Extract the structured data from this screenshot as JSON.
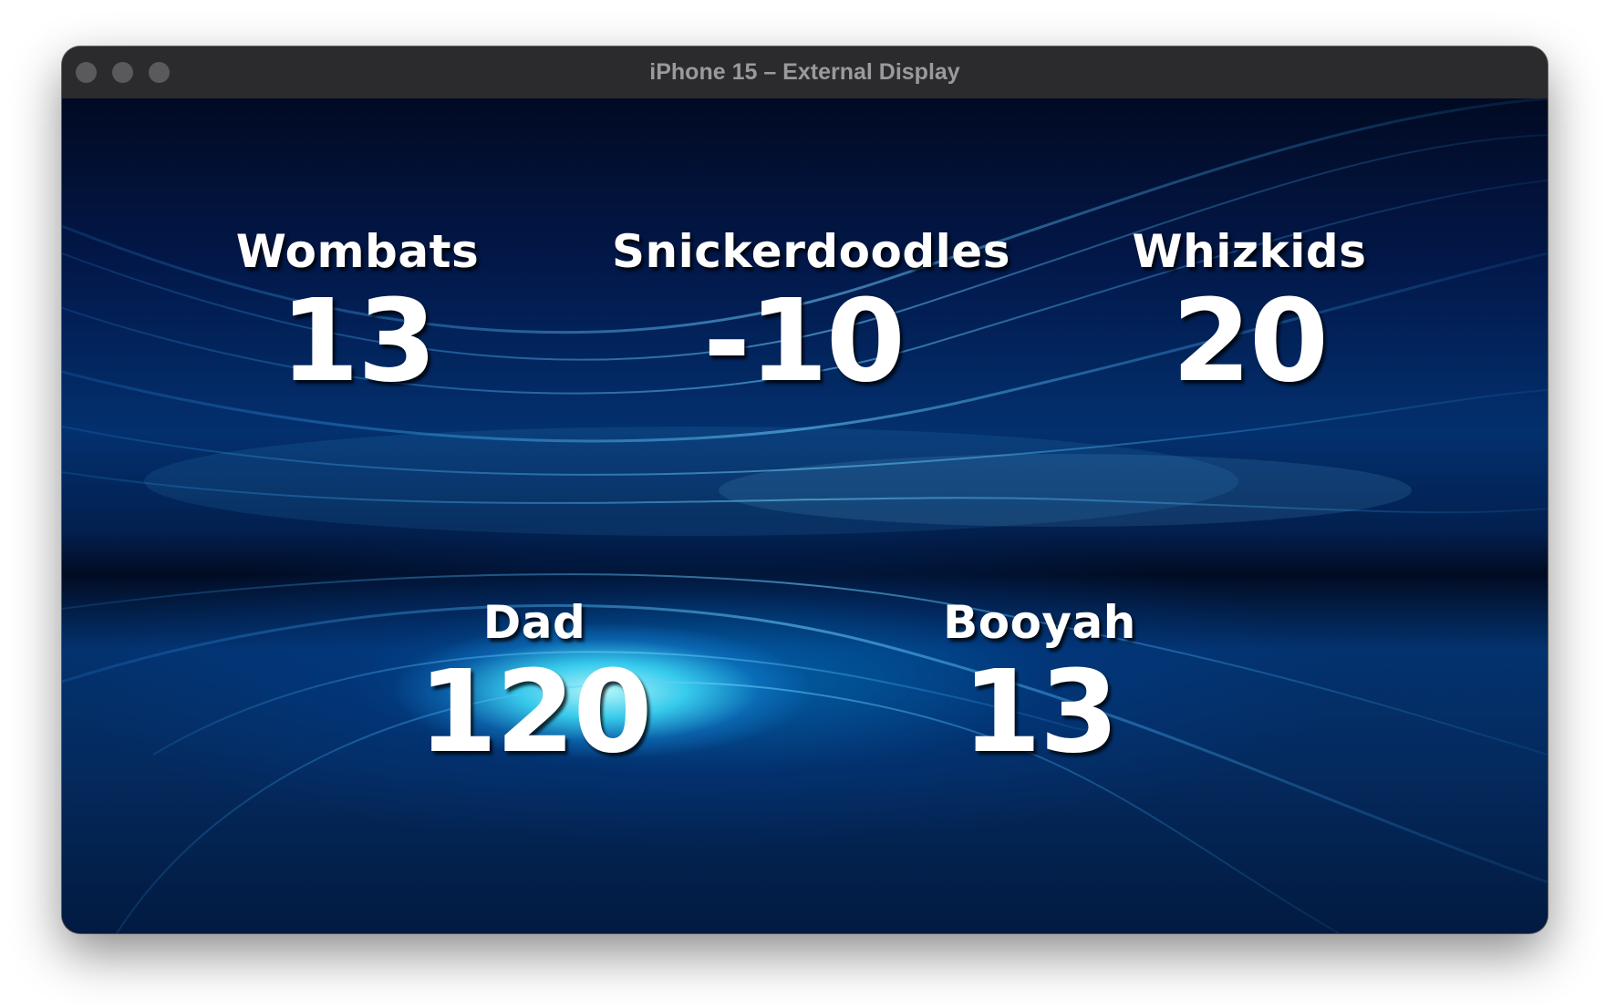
{
  "window": {
    "title": "iPhone 15 – External Display"
  },
  "scoreboard": {
    "teams": [
      {
        "name": "Wombats",
        "score": "13"
      },
      {
        "name": "Snickerdoodles",
        "score": "-10"
      },
      {
        "name": "Whizkids",
        "score": "20"
      },
      {
        "name": "Dad",
        "score": "120"
      },
      {
        "name": "Booyah",
        "score": "13"
      }
    ]
  },
  "colors": {
    "titlebar": "#2b2b2d",
    "title_text": "#9a9a9c",
    "traffic_light_inactive": "#5a5a5c",
    "score_text": "#ffffff",
    "background_glow": "#3cd7f5",
    "background_deep": "#021f4e"
  },
  "icons": {
    "close": "close-traffic-light-icon",
    "minimize": "minimize-traffic-light-icon",
    "zoom": "zoom-traffic-light-icon"
  }
}
